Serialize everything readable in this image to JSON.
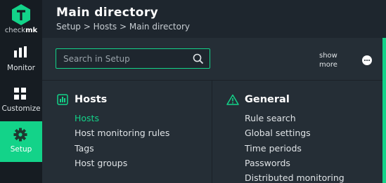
{
  "sidebar": {
    "logo_text_a": "check",
    "logo_text_b": "mk",
    "items": [
      {
        "label": "Monitor"
      },
      {
        "label": "Customize"
      },
      {
        "label": "Setup"
      }
    ]
  },
  "header": {
    "title": "Main directory",
    "breadcrumb": "Setup > Hosts > Main directory"
  },
  "search": {
    "placeholder": "Search in Setup",
    "value": ""
  },
  "toolbar": {
    "show_more_line1": "show",
    "show_more_line2": "more"
  },
  "sections": {
    "hosts": {
      "title": "Hosts",
      "links": [
        "Hosts",
        "Host monitoring rules",
        "Tags",
        "Host groups"
      ]
    },
    "general": {
      "title": "General",
      "links": [
        "Rule search",
        "Global settings",
        "Time periods",
        "Passwords",
        "Distributed monitoring"
      ]
    }
  },
  "colors": {
    "accent": "#13d389",
    "sidebar_bg": "#161c22",
    "content_bg": "#252e36"
  },
  "icons": [
    "checkmk-logo-icon",
    "monitor-bars-icon",
    "customize-grid-icon",
    "setup-gear-icon",
    "search-icon",
    "more-dots-icon",
    "hosts-chart-icon",
    "warning-triangle-icon"
  ]
}
